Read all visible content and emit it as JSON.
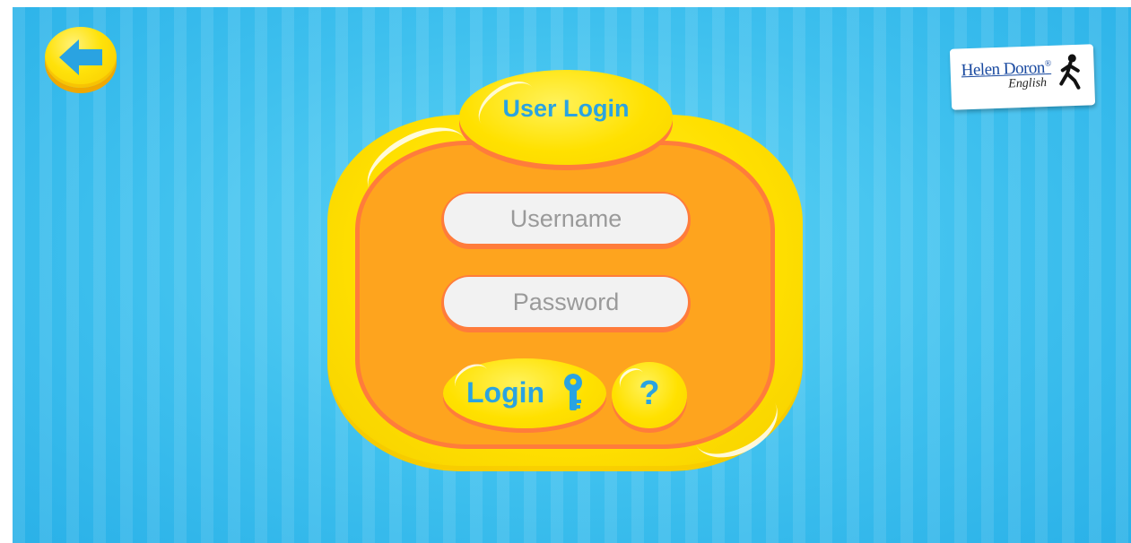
{
  "back_button": {
    "icon": "arrow-left-icon"
  },
  "logo": {
    "brand": "Helen Doron",
    "trademark": "®",
    "sub": "English",
    "icon": "walking-figure-icon"
  },
  "login_panel": {
    "title": "User Login",
    "username": {
      "placeholder": "Username",
      "value": ""
    },
    "password": {
      "placeholder": "Password",
      "value": ""
    },
    "login_button": {
      "label": "Login",
      "icon": "key-icon"
    },
    "help_button": {
      "label": "?"
    }
  },
  "colors": {
    "background": "#3ec0ee",
    "panel_yellow": "#ffe000",
    "panel_orange": "#fea41e",
    "panel_border": "#ff7c3b",
    "text_blue": "#2aa3e1",
    "field_bg": "#f2f2f2"
  }
}
